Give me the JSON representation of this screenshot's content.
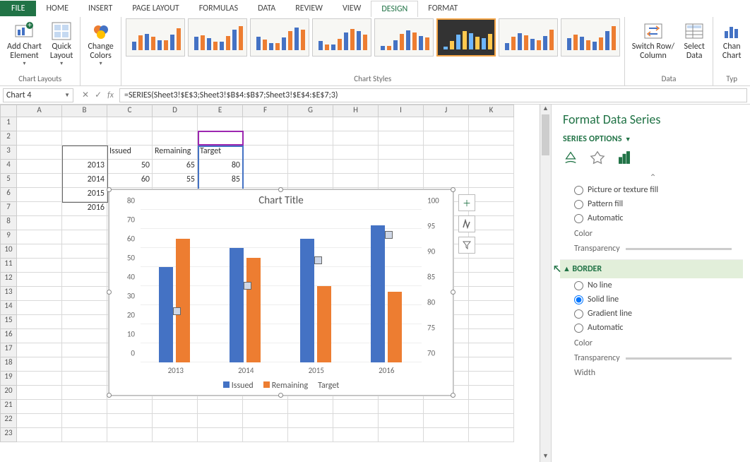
{
  "tabs": [
    "FILE",
    "HOME",
    "INSERT",
    "PAGE LAYOUT",
    "FORMULAS",
    "DATA",
    "REVIEW",
    "VIEW",
    "DESIGN",
    "FORMAT"
  ],
  "active_tab": "DESIGN",
  "ribbon": {
    "groups": {
      "chart_layouts": {
        "label": "Chart Layouts",
        "add_element": "Add Chart\nElement",
        "quick_layout": "Quick\nLayout"
      },
      "change_colors": "Change\nColors",
      "chart_styles": {
        "label": "Chart Styles"
      },
      "data": {
        "label": "Data",
        "switch": "Switch Row/\nColumn",
        "select": "Select\nData"
      },
      "type": {
        "label": "Typ",
        "change": "Chan\nChart"
      }
    }
  },
  "formula_bar": {
    "name": "Chart 4",
    "formula": "=SERIES(Sheet3!$E$3;Sheet3!$B$4:$B$7;Sheet3!$E$4:$E$7;3)"
  },
  "columns": [
    "A",
    "B",
    "C",
    "D",
    "E",
    "F",
    "G",
    "H",
    "I",
    "J",
    "K"
  ],
  "rows": 23,
  "sheet": {
    "headers": [
      "Issued",
      "Remaining",
      "Target"
    ],
    "data": [
      {
        "year": "2013",
        "issued": 50,
        "remaining": 65,
        "target": 80
      },
      {
        "year": "2014",
        "issued": 60,
        "remaining": 55,
        "target": 85
      },
      {
        "year": "2015"
      },
      {
        "year": "2016"
      }
    ]
  },
  "chart": {
    "title": "Chart Title",
    "legend": [
      "Issued",
      "Remaining",
      "Target"
    ]
  },
  "chart_data": {
    "type": "bar",
    "title": "Chart Title",
    "categories": [
      "2013",
      "2014",
      "2015",
      "2016"
    ],
    "series": [
      {
        "name": "Issued",
        "axis": "primary",
        "values": [
          50,
          60,
          65,
          72
        ]
      },
      {
        "name": "Remaining",
        "axis": "primary",
        "values": [
          65,
          55,
          40,
          37
        ]
      },
      {
        "name": "Target",
        "axis": "secondary",
        "values": [
          80,
          85,
          90,
          95
        ]
      }
    ],
    "primary_axis": {
      "min": 0,
      "max": 80,
      "ticks": [
        0,
        10,
        20,
        30,
        40,
        50,
        60,
        70,
        80
      ]
    },
    "secondary_axis": {
      "min": 70,
      "max": 100,
      "ticks": [
        70,
        75,
        80,
        85,
        90,
        95,
        100
      ]
    },
    "xlabel": "",
    "ylabel": ""
  },
  "format_pane": {
    "title": "Format Data Series",
    "sub": "SERIES OPTIONS",
    "fill_opts": [
      "Picture or texture fill",
      "Pattern fill",
      "Automatic"
    ],
    "color": "Color",
    "transparency": "Transparency",
    "border": "BORDER",
    "border_opts": [
      "No line",
      "Solid line",
      "Gradient line",
      "Automatic"
    ],
    "border_selected": "Solid line",
    "width": "Width"
  }
}
